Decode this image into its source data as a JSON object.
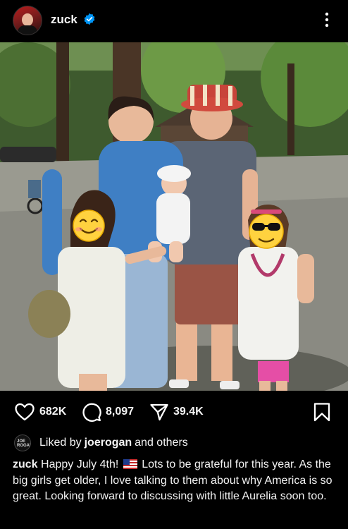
{
  "post": {
    "username": "zuck",
    "verified": true,
    "menu_icon": "more-vertical-icon"
  },
  "photo": {
    "avatar_icon": "profile-avatar",
    "faces_hidden_with": [
      "smiling-face-emoji",
      "sunglasses-face-emoji"
    ]
  },
  "actions": {
    "likes": "682K",
    "comments": "8,097",
    "shares": "39.4K",
    "like_icon": "heart-icon",
    "comment_icon": "comment-bubble-icon",
    "share_icon": "send-icon",
    "save_icon": "bookmark-icon"
  },
  "liked_by": {
    "prefix": "Liked by",
    "user": "joerogan",
    "suffix": "and others",
    "avatar_text": "JOE ROGAN"
  },
  "caption": {
    "username": "zuck",
    "text_before_flag": "Happy July 4th!",
    "flag_icon": "us-flag-emoji",
    "text_after_flag": "Lots to be grateful for this year. As the big girls get older, I love talking to them about why America is so great. Looking forward to discussing with little Aurelia soon too."
  },
  "colors": {
    "background": "#000000",
    "verified_badge": "#0095f6",
    "text": "#f5f5f5"
  }
}
